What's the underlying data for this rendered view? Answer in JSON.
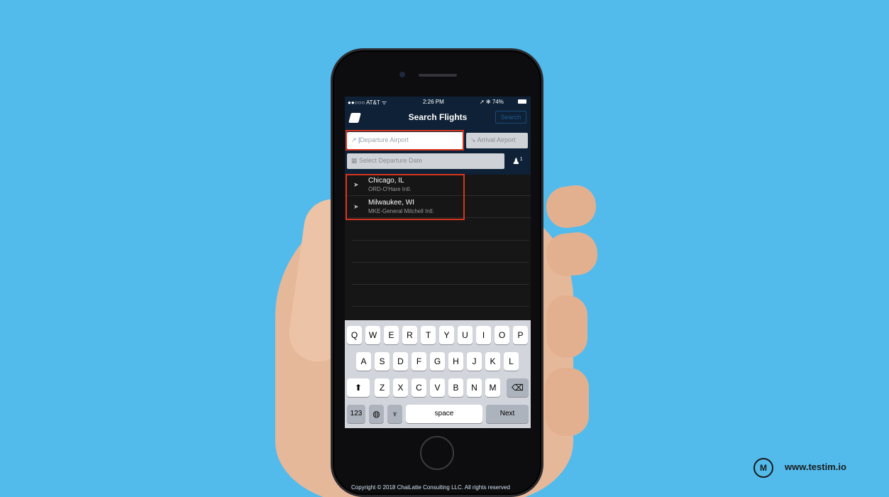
{
  "status": {
    "carrier": "●●○○○ AT&T ᯤ",
    "time": "2:26 PM",
    "battery": "➚ ✻ 74%"
  },
  "header": {
    "title": "Search Flights",
    "search_label": "Search"
  },
  "form": {
    "departure_placeholder": "Departure Airport",
    "arrival_placeholder": "Arrival Airport",
    "date_placeholder": "Select Departure Date",
    "passenger_count": "1"
  },
  "results": [
    {
      "city": "Chicago, IL",
      "code": "ORD-O'Hare Intl."
    },
    {
      "city": "Milwaukee, WI",
      "code": "MKE-General Mitchell Intl."
    }
  ],
  "keyboard": {
    "row1": [
      "Q",
      "W",
      "E",
      "R",
      "T",
      "Y",
      "U",
      "I",
      "O",
      "P"
    ],
    "row2": [
      "A",
      "S",
      "D",
      "F",
      "G",
      "H",
      "J",
      "K",
      "L"
    ],
    "row3": [
      "Z",
      "X",
      "C",
      "V",
      "B",
      "N",
      "M"
    ],
    "numbers_label": "123",
    "space_label": "space",
    "next_label": "Next"
  },
  "footer": {
    "copyright": "Copyright © 2018 ChaiLatte Consulting LLC. All rights reserved",
    "brand_logo": "M",
    "brand_url": "www.testim.io"
  }
}
